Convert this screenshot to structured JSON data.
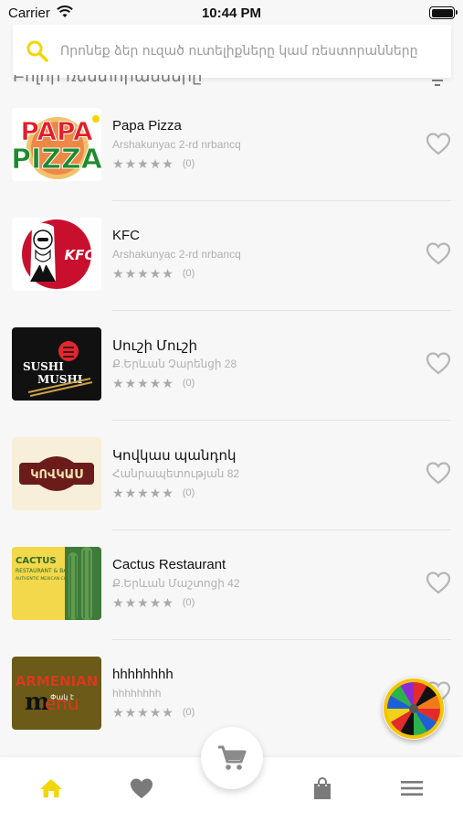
{
  "status_bar": {
    "carrier": "Carrier",
    "time": "10:44 PM"
  },
  "search": {
    "placeholder": "Որոնեք ձեր ուզած ուտելիքները կամ ռեստորանները"
  },
  "section": {
    "title": "Բոլոր ռեստորանները"
  },
  "colors": {
    "accent": "#f2d600",
    "heart": "#b5b5b5",
    "icon_gray": "#7a7a7a"
  },
  "restaurants": [
    {
      "name": "Papa Pizza",
      "address": "Arshakunyac 2-rd nrbancq",
      "rating_count": "(0)",
      "logo": "papa-pizza-logo",
      "logo_text": "PAPA PIZZA"
    },
    {
      "name": "KFC",
      "address": "Arshakunyac 2-rd nrbancq",
      "rating_count": "(0)",
      "logo": "kfc-logo",
      "logo_text": "KFC"
    },
    {
      "name": "Սուշի Մուշի",
      "address": "Ք.Երևան Չարենցի 28",
      "rating_count": "(0)",
      "logo": "sushi-mushi-logo",
      "logo_text": "SUSHI MUSHI"
    },
    {
      "name": "Կովկաս պանդոկ",
      "address": "Հանրապետության 82",
      "rating_count": "(0)",
      "logo": "kovkas-logo",
      "logo_text": "ԿՈՎԿԱՍ"
    },
    {
      "name": "Cactus Restaurant",
      "address": "Ք.Երևան Մաշտոցի 42",
      "rating_count": "(0)",
      "logo": "cactus-logo",
      "logo_text": "CACTUS RESTAURANT & BAR AUTHENTIC MEXICAN CUISINE"
    },
    {
      "name": "hhhhhhhh",
      "address": "hhhhhhhh",
      "rating_count": "(0)",
      "logo": "armenian-menu-logo",
      "logo_text": "ARMENIAN Փակ է menu"
    }
  ],
  "tabs": [
    {
      "name": "home-icon",
      "active": true
    },
    {
      "name": "heart-icon",
      "active": false
    },
    {
      "name": "cart-icon",
      "active": false
    },
    {
      "name": "shopping-bag-icon",
      "active": false
    },
    {
      "name": "menu-icon",
      "active": false
    }
  ]
}
